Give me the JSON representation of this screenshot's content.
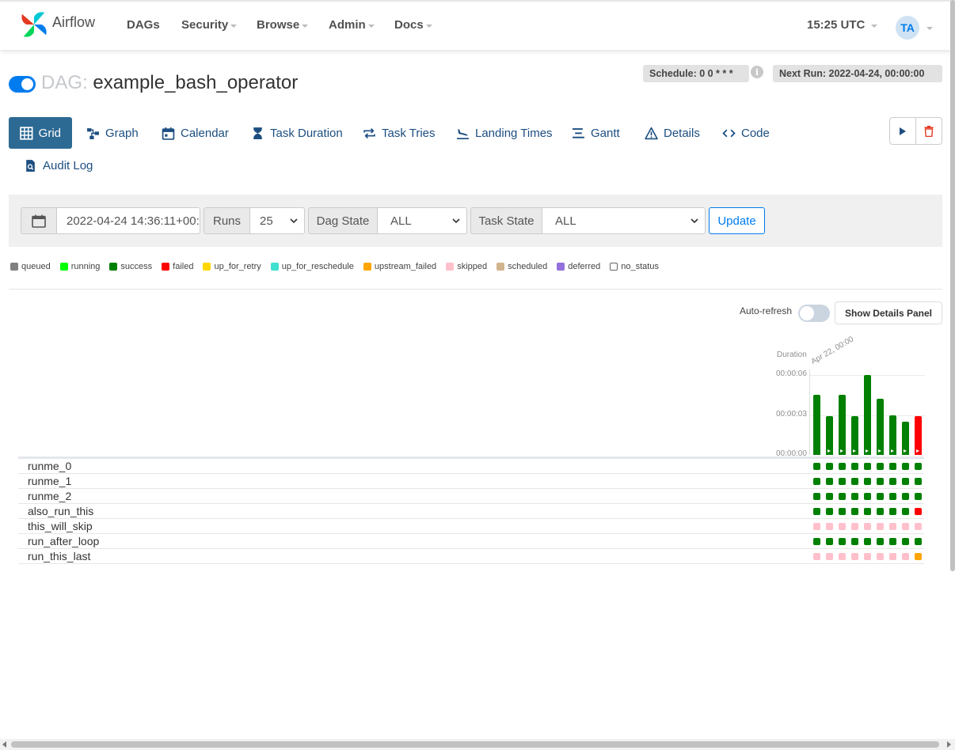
{
  "navbar": {
    "brand": "Airflow",
    "menu": [
      {
        "label": "DAGs",
        "dropdown": false
      },
      {
        "label": "Security",
        "dropdown": true
      },
      {
        "label": "Browse",
        "dropdown": true
      },
      {
        "label": "Admin",
        "dropdown": true
      },
      {
        "label": "Docs",
        "dropdown": true
      }
    ],
    "clock": "15:25 UTC",
    "avatar_initials": "TA"
  },
  "dag": {
    "prefix": "DAG:",
    "name": "example_bash_operator",
    "paused": false,
    "schedule": "Schedule: 0 0 * * *",
    "next_run": "Next Run: 2022-04-24, 00:00:00"
  },
  "tabs": [
    {
      "label": "Grid",
      "icon": "grid-icon",
      "active": true
    },
    {
      "label": "Graph",
      "icon": "graph-icon"
    },
    {
      "label": "Calendar",
      "icon": "calendar-icon"
    },
    {
      "label": "Task Duration",
      "icon": "hourglass-icon"
    },
    {
      "label": "Task Tries",
      "icon": "retry-icon"
    },
    {
      "label": "Landing Times",
      "icon": "plane-landing-icon"
    },
    {
      "label": "Gantt",
      "icon": "gantt-icon"
    },
    {
      "label": "Details",
      "icon": "warning-triangle-icon"
    },
    {
      "label": "Code",
      "icon": "code-icon"
    },
    {
      "label": "Audit Log",
      "icon": "file-search-icon"
    }
  ],
  "filters": {
    "base_date": "2022-04-24 14:36:11+00:",
    "runs_label": "Runs",
    "runs_value": "25",
    "dag_state_label": "Dag State",
    "dag_state_value": "ALL",
    "task_state_label": "Task State",
    "task_state_value": "ALL",
    "update_label": "Update"
  },
  "legend": [
    {
      "label": "queued",
      "color": "#808080"
    },
    {
      "label": "running",
      "color": "#00ff00"
    },
    {
      "label": "success",
      "color": "#008000"
    },
    {
      "label": "failed",
      "color": "#ff0000"
    },
    {
      "label": "up_for_retry",
      "color": "#ffd700"
    },
    {
      "label": "up_for_reschedule",
      "color": "#40e0d0"
    },
    {
      "label": "upstream_failed",
      "color": "#ffa500"
    },
    {
      "label": "skipped",
      "color": "#ffc0cb"
    },
    {
      "label": "scheduled",
      "color": "#d2b48c"
    },
    {
      "label": "deferred",
      "color": "#9370db"
    },
    {
      "label": "no_status",
      "color": "#ffffff"
    }
  ],
  "auto_refresh": {
    "label": "Auto-refresh",
    "enabled": false
  },
  "details_button": "Show Details Panel",
  "grid": {
    "duration_label": "Duration",
    "first_run_label": "Apr 22, 00:00",
    "ticks": [
      "00:00:06",
      "00:00:03",
      "00:00:00"
    ],
    "tick_seconds": [
      6,
      3,
      0
    ],
    "run_durations_s": [
      4.5,
      2.9,
      4.5,
      2.9,
      6.0,
      4.2,
      3.0,
      2.5,
      2.9
    ],
    "run_states": [
      "success",
      "success",
      "success",
      "success",
      "success",
      "success",
      "success",
      "success",
      "failed"
    ],
    "tasks": [
      {
        "name": "runme_0",
        "states": [
          "success",
          "success",
          "success",
          "success",
          "success",
          "success",
          "success",
          "success",
          "success"
        ]
      },
      {
        "name": "runme_1",
        "states": [
          "success",
          "success",
          "success",
          "success",
          "success",
          "success",
          "success",
          "success",
          "success"
        ]
      },
      {
        "name": "runme_2",
        "states": [
          "success",
          "success",
          "success",
          "success",
          "success",
          "success",
          "success",
          "success",
          "success"
        ]
      },
      {
        "name": "also_run_this",
        "states": [
          "success",
          "success",
          "success",
          "success",
          "success",
          "success",
          "success",
          "success",
          "failed"
        ]
      },
      {
        "name": "this_will_skip",
        "states": [
          "skipped",
          "skipped",
          "skipped",
          "skipped",
          "skipped",
          "skipped",
          "skipped",
          "skipped",
          "skipped"
        ]
      },
      {
        "name": "run_after_loop",
        "states": [
          "success",
          "success",
          "success",
          "success",
          "success",
          "success",
          "success",
          "success",
          "success"
        ]
      },
      {
        "name": "run_this_last",
        "states": [
          "skipped",
          "skipped",
          "skipped",
          "skipped",
          "skipped",
          "skipped",
          "skipped",
          "skipped",
          "upstream_failed"
        ]
      }
    ]
  }
}
